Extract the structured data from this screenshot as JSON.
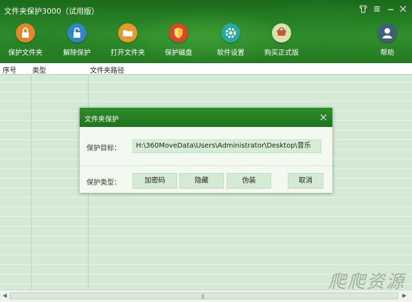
{
  "app": {
    "title": "文件夹保护3000（试用版）"
  },
  "window_controls": [
    "shirt-icon",
    "menu-icon",
    "minimize-icon",
    "close-icon"
  ],
  "toolbar": {
    "items": [
      {
        "label": "保护文件夹",
        "icon": "lock-icon",
        "color": "#e6862a"
      },
      {
        "label": "解除保护",
        "icon": "unlock-icon",
        "color": "#2f86c8"
      },
      {
        "label": "打开文件夹",
        "icon": "folder-icon",
        "color": "#e39a2a"
      },
      {
        "label": "保护磁盘",
        "icon": "shield-icon",
        "color": "#d9452a"
      },
      {
        "label": "软件设置",
        "icon": "gear-icon",
        "color": "#28a8a0"
      },
      {
        "label": "购买正式版",
        "icon": "cart-icon",
        "color": "#d7e2b0"
      },
      {
        "label": "帮助",
        "icon": "user-help-icon",
        "color": "#3f5f7a"
      }
    ]
  },
  "table": {
    "columns": [
      "序号",
      "类型",
      "文件夹路径"
    ],
    "rows": []
  },
  "dialog": {
    "title": "文件夹保护",
    "target_label": "保护目标：",
    "target_path": "H:\\360MoveData\\Users\\Administrator\\Desktop\\音乐",
    "type_label": "保护类型：",
    "buttons": {
      "encrypt": "加密码",
      "hide": "隐藏",
      "disguise": "伪装",
      "cancel": "取消"
    }
  },
  "watermark": "爬爬资源",
  "scrollbar": {
    "grip": "|||"
  }
}
